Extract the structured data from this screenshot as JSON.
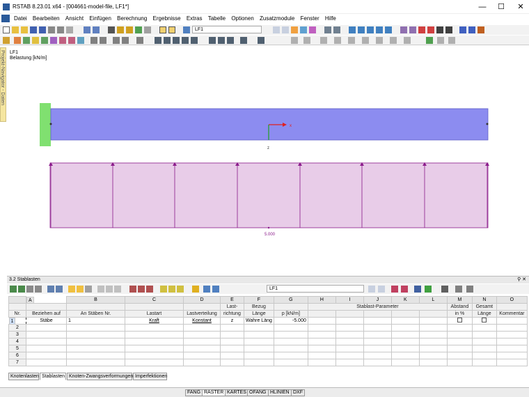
{
  "window": {
    "title": "RSTAB 8.23.01 x64 - [004661-model-file, LF1*]",
    "minimize": "—",
    "maximize": "☐",
    "close": "✕"
  },
  "menu": [
    "Datei",
    "Bearbeiten",
    "Ansicht",
    "Einfügen",
    "Berechnung",
    "Ergebnisse",
    "Extras",
    "Tabelle",
    "Optionen",
    "Zusatzmodule",
    "Fenster",
    "Hilfe"
  ],
  "toolbar": {
    "loadcase": "LF1"
  },
  "navigator": {
    "label": "Projekt-Navigator - Daten"
  },
  "view": {
    "line1": "LF1",
    "line2": "Belastung [kN/m]",
    "axis_x": "x",
    "axis_z": "z",
    "load_value": "5.000"
  },
  "panel": {
    "title": "3.2 Stablasten",
    "loadcase": "LF1",
    "pin": "⚲ ✕"
  },
  "table": {
    "letters": [
      "A",
      "B",
      "C",
      "D",
      "E",
      "F",
      "G",
      "H",
      "I",
      "J",
      "K",
      "L",
      "M",
      "N",
      "O"
    ],
    "header1": {
      "nr": "",
      "e": "Last-",
      "f": "Bezug",
      "params": "Stablast-Parameter",
      "m": "Abstand",
      "n": "Gesamt"
    },
    "header2": {
      "nr": "Nr.",
      "a": "Beziehen auf",
      "b": "An Stäben Nr.",
      "c": "Lastart",
      "d": "Lastverteilung",
      "e": "richtung",
      "f": "Länge",
      "g": "p [kN/m]",
      "m": "in %",
      "n": "Länge",
      "o": "Kommentar"
    },
    "row1": {
      "nr": "1",
      "a": "Stäbe",
      "b": "1",
      "c": "Kraft",
      "d": "Konstant",
      "e": "z",
      "f": "Wahre Läng",
      "g": "-5.000"
    },
    "row_numbers": [
      "2",
      "3",
      "4",
      "5",
      "6",
      "7"
    ]
  },
  "tabs": [
    "Knotenlasten",
    "Stablasten",
    "Knoten-Zwangsverformungen",
    "Imperfektionen"
  ],
  "status": [
    "FANG",
    "RASTER",
    "KARTES",
    "OFANG",
    "HLINIEN",
    "DXF"
  ],
  "colors": {
    "beam": "#8c8cf0",
    "support": "#80e070",
    "load": "#e8cce8",
    "load_line": "#8a1a8a"
  }
}
